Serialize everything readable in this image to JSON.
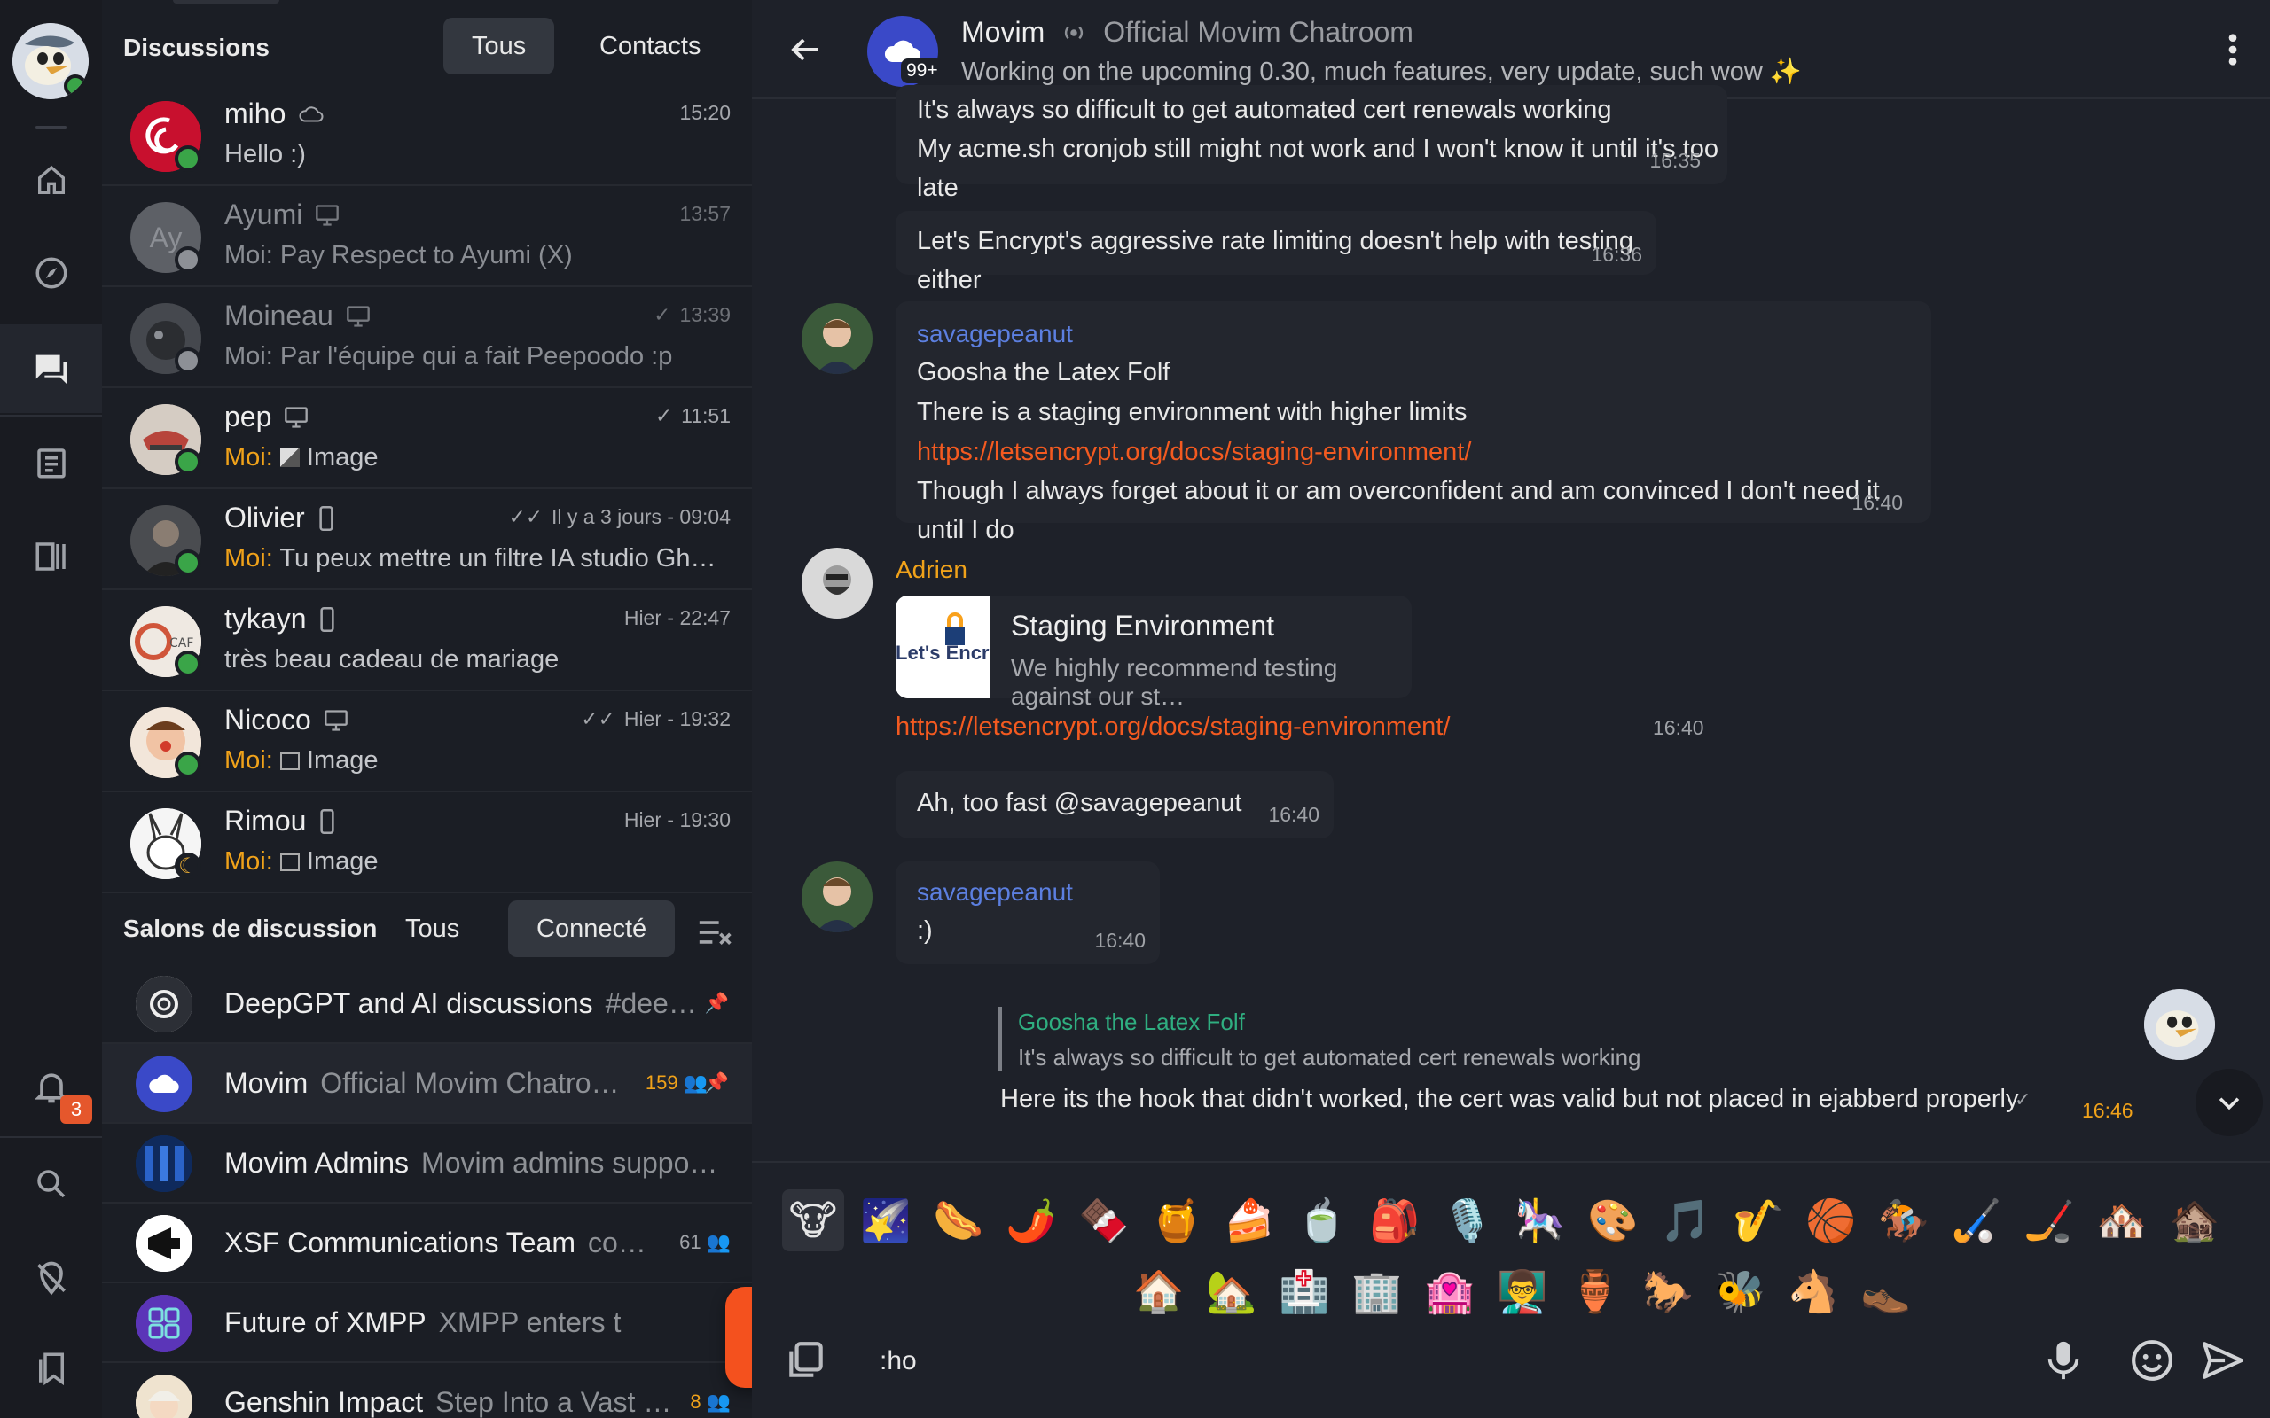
{
  "discussions": {
    "title": "Discussions",
    "filter_all": "Tous",
    "filter_contacts": "Contacts",
    "contacts": [
      {
        "name": "miho",
        "message": "Hello :)",
        "time": "15:20",
        "status": "online",
        "device": "cloud-icon",
        "dim": false,
        "me": ""
      },
      {
        "name": "Ayumi",
        "message": "Moi: Pay Respect to Ayumi (X)",
        "time": "13:57",
        "status": "offline",
        "device": "desktop-icon",
        "dim": true,
        "me": ""
      },
      {
        "name": "Moineau",
        "message": "Moi: Par l'équipe qui a fait Peepoodo :p",
        "time": "13:39",
        "status": "offline",
        "device": "desktop-icon",
        "dim": true,
        "me": ""
      },
      {
        "name": "pep",
        "message": "Image",
        "time": "11:51",
        "status": "online",
        "device": "desktop-icon",
        "dim": false,
        "me": "Moi:"
      },
      {
        "name": "Olivier",
        "message": "Tu peux mettre un filtre IA studio Ghibli dessus",
        "time": "Il y a 3 jours - 09:04",
        "status": "online",
        "device": "phone-icon",
        "dim": false,
        "me": "Moi:"
      },
      {
        "name": "tykayn",
        "message": "très beau cadeau de mariage",
        "time": "Hier - 22:47",
        "status": "online",
        "device": "phone-icon",
        "dim": false,
        "me": ""
      },
      {
        "name": "Nicoco",
        "message": "Image",
        "time": "Hier - 19:32",
        "status": "online",
        "device": "desktop-icon",
        "dim": false,
        "me": "Moi:"
      },
      {
        "name": "Rimou",
        "message": "Image",
        "time": "Hier - 19:30",
        "status": "away",
        "device": "phone-icon",
        "dim": false,
        "me": "Moi:"
      }
    ]
  },
  "rooms": {
    "title": "Salons de discussion",
    "filter_all": "Tous",
    "filter_connected": "Connecté",
    "items": [
      {
        "name": "DeepGPT and AI discussions",
        "sub": "#dee…",
        "count": "",
        "pinned": true
      },
      {
        "name": "Movim",
        "sub": "Official Movim Chatro…",
        "count": "159",
        "pinned": true
      },
      {
        "name": "Movim Admins",
        "sub": "Movim admins suppo…",
        "count": "",
        "pinned": false
      },
      {
        "name": "XSF Communications Team",
        "sub": "co…",
        "count": "61",
        "pinned": false
      },
      {
        "name": "Future of XMPP",
        "sub": "XMPP enters t",
        "count": "",
        "pinned": false
      },
      {
        "name": "Genshin Impact",
        "sub": "Step Into a Vast …",
        "count": "8",
        "pinned": false
      }
    ]
  },
  "header": {
    "room_name": "Movim",
    "room_desc": "Official Movim Chatroom",
    "subject": "Working on the upcoming 0.30, much features, very update, such wow ✨",
    "unread_badge": "99+"
  },
  "messages": {
    "m1_line1": "It's always so difficult to get automated cert renewals working",
    "m1_line2": "My acme.sh cronjob still might not work and I won't know it until it's too late",
    "m1_time": "16:35",
    "m2_text": "Let's Encrypt's aggressive rate limiting doesn't help with testing either",
    "m2_time": "16:36",
    "m3_author": "savagepeanut",
    "m3_line1": "Goosha the Latex Folf",
    "m3_line2": "There is a staging environment with higher limits",
    "m3_link": "https://letsencrypt.org/docs/staging-environment/",
    "m3_line4": "Though I always forget about it or am overconfident and am convinced I don't need it until I do",
    "m3_time": "16:40",
    "m4_author": "Adrien",
    "m4_card_title": "Staging Environment",
    "m4_card_desc": "We highly recommend testing against our st…",
    "m4_card_logo": "Let's Encrypt",
    "m4_link": "https://letsencrypt.org/docs/staging-environment/",
    "m4_time": "16:40",
    "m5_text": "Ah, too fast @savagepeanut",
    "m5_time": "16:40",
    "m6_author": "savagepeanut",
    "m6_text": ":)",
    "m6_time": "16:40",
    "m7_quote_author": "Goosha the Latex Folf",
    "m7_quote_text": "It's always so difficult to get automated cert renewals working",
    "m7_text": "Here its the hook that didn't worked, the cert was valid but not placed in ejabberd properly",
    "m7_time": "16:46"
  },
  "emojis": [
    "🐮",
    "🌠",
    "🌭",
    "🌶️",
    "🍫",
    "🍯",
    "🍰",
    "🍵",
    "🎒",
    "🎙️",
    "🎠",
    "🎨",
    "🎵",
    "🎷",
    "🏀",
    "🏇",
    "🏑",
    "🏒",
    "🏘️",
    "🏚️",
    "🏠",
    "🏡",
    "🏥",
    "🏢",
    "🏩",
    "👨‍🏫",
    "🏺",
    "🐎",
    "🐝",
    "🐴",
    "👞"
  ],
  "composer": {
    "value": ":ho"
  },
  "notifications": {
    "count": "3"
  },
  "colors": {
    "accent": "#f4511e",
    "online": "#3aa548",
    "away": "#f2b233",
    "author_blue": "#5c7fe0",
    "author_orange": "#f0a21a",
    "quote_green": "#2fae80"
  }
}
